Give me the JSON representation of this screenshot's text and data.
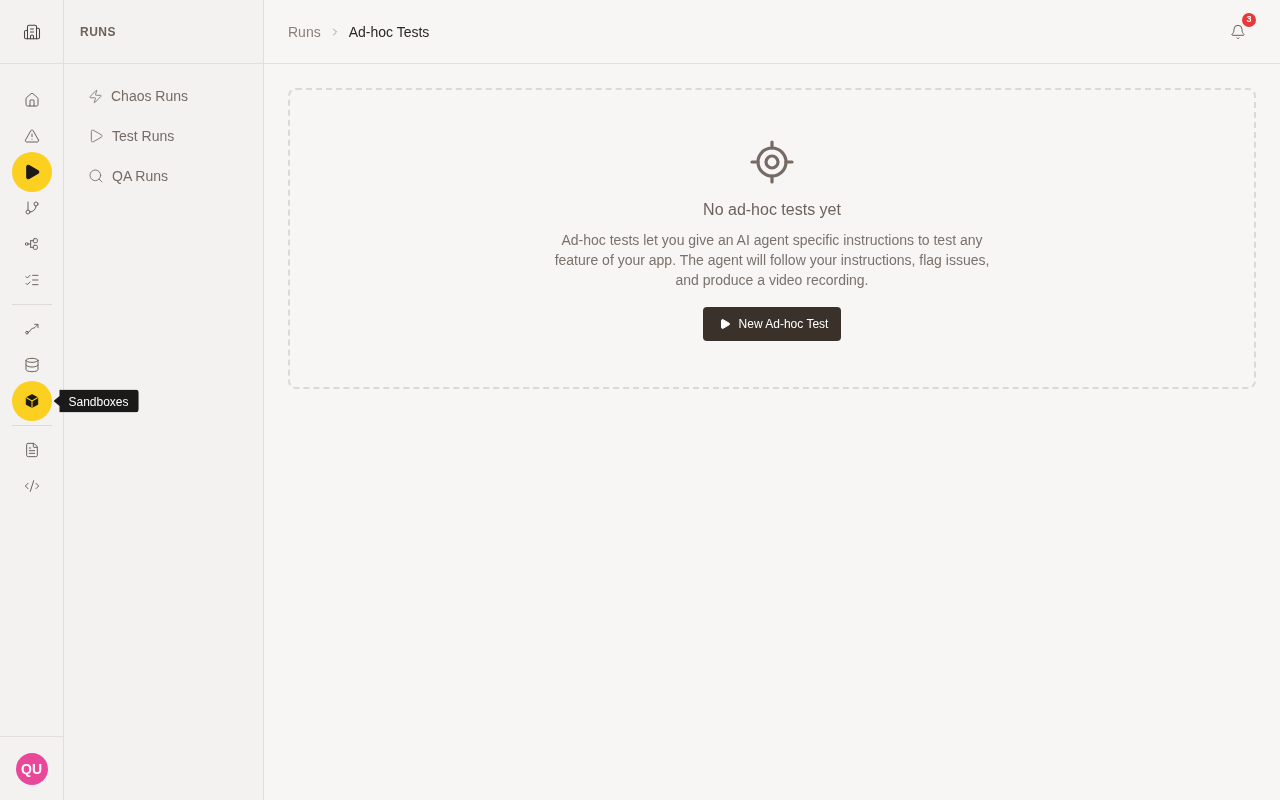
{
  "rail": {
    "groups": [
      {
        "items": [
          {
            "kind": "home",
            "selected": false,
            "hovered": false
          },
          {
            "kind": "alert",
            "selected": false,
            "hovered": false
          },
          {
            "kind": "play",
            "selected": true,
            "hovered": false
          },
          {
            "kind": "branch",
            "selected": false,
            "hovered": false
          },
          {
            "kind": "nodes",
            "selected": false,
            "hovered": false
          },
          {
            "kind": "checklist",
            "selected": false,
            "hovered": false
          }
        ]
      },
      {
        "items": [
          {
            "kind": "route",
            "selected": false,
            "hovered": false
          },
          {
            "kind": "database",
            "selected": false,
            "hovered": false
          },
          {
            "kind": "box",
            "selected": false,
            "hovered": true,
            "tooltip": "Sandboxes"
          }
        ]
      },
      {
        "items": [
          {
            "kind": "document",
            "selected": false,
            "hovered": false
          },
          {
            "kind": "code",
            "selected": false,
            "hovered": false
          }
        ]
      }
    ]
  },
  "user": {
    "initials": "QU"
  },
  "sidebar": {
    "title": "RUNS",
    "items": [
      {
        "kind": "zap",
        "label": "Chaos Runs",
        "selected": false
      },
      {
        "kind": "play",
        "label": "Test Runs",
        "selected": false
      },
      {
        "kind": "search",
        "label": "QA Runs",
        "selected": false
      }
    ]
  },
  "breadcrumb": [
    {
      "label": "Runs",
      "current": false
    },
    {
      "label": "Ad-hoc Tests",
      "current": true
    }
  ],
  "notifications": {
    "count": "3"
  },
  "empty_state": {
    "title": "No ad-hoc tests yet",
    "description": "Ad-hoc tests let you give an AI agent specific instructions to test any feature of your app. The agent will follow your instructions, flag issues, and produce a video recording.",
    "button": {
      "label": "New Ad-hoc Test"
    }
  }
}
